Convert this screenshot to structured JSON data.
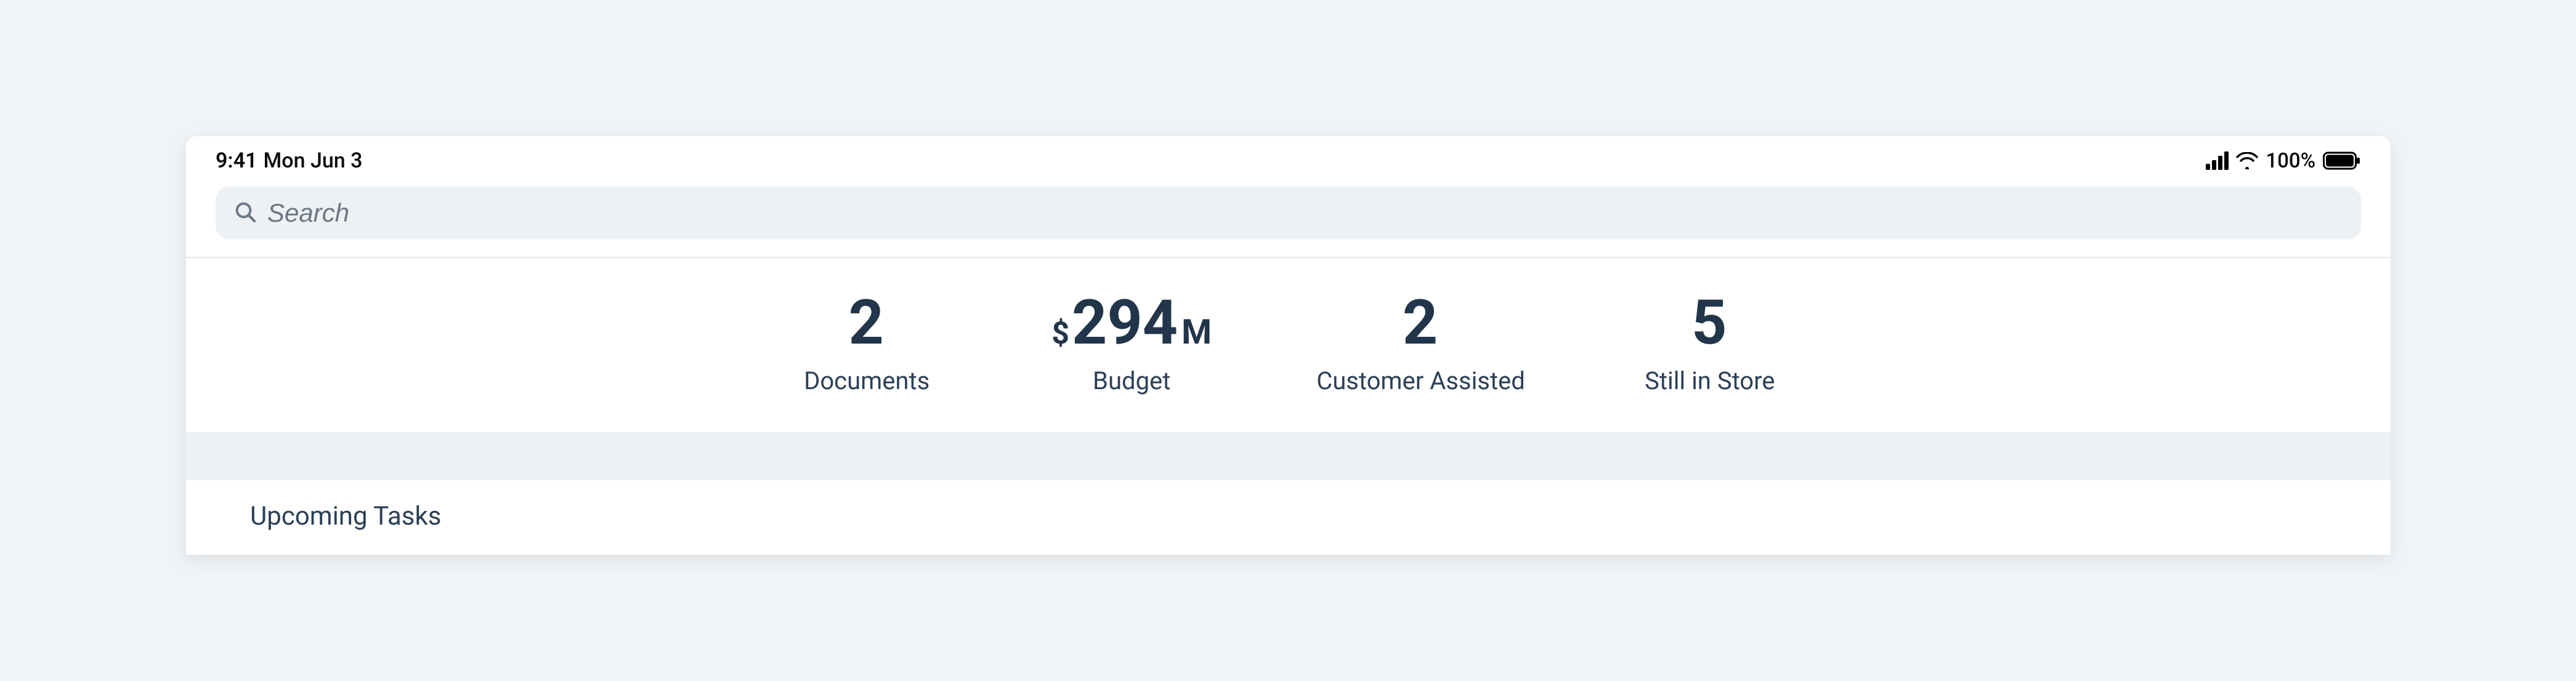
{
  "status_bar": {
    "time": "9:41",
    "date": "Mon Jun 3",
    "battery_percent": "100%"
  },
  "search": {
    "placeholder": "Search"
  },
  "stats": [
    {
      "value": "2",
      "prefix": "",
      "suffix": "",
      "label": "Documents"
    },
    {
      "value": "294",
      "prefix": "$",
      "suffix": "M",
      "label": "Budget"
    },
    {
      "value": "2",
      "prefix": "",
      "suffix": "",
      "label": "Customer Assisted"
    },
    {
      "value": "5",
      "prefix": "",
      "suffix": "",
      "label": "Still in Store"
    }
  ],
  "tasks": {
    "title": "Upcoming Tasks"
  },
  "colors": {
    "dark_navy": "#22354a",
    "page_bg": "#f1f4f6",
    "search_bg": "#eef1f4"
  }
}
